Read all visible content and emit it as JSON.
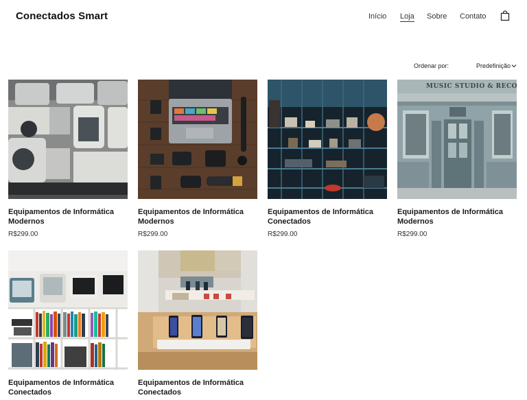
{
  "header": {
    "brand": "Conectados Smart",
    "nav": [
      {
        "label": "Início"
      },
      {
        "label": "Loja"
      },
      {
        "label": "Sobre"
      },
      {
        "label": "Contato"
      }
    ]
  },
  "sort": {
    "label": "Ordenar por:",
    "value": "Predefinição"
  },
  "products": [
    {
      "title": "Equipamentos de Informática Modernos",
      "price": "R$299.00"
    },
    {
      "title": "Equipamentos de Informática Modernos",
      "price": "R$299.00"
    },
    {
      "title": "Equipamentos de Informática Conectados",
      "price": "R$299.00"
    },
    {
      "title": "Equipamentos de Informática Modernos",
      "price": "R$299.00"
    },
    {
      "title": "Equipamentos de Informática Conectados",
      "price": ""
    },
    {
      "title": "Equipamentos de Informática Conectados",
      "price": ""
    }
  ]
}
